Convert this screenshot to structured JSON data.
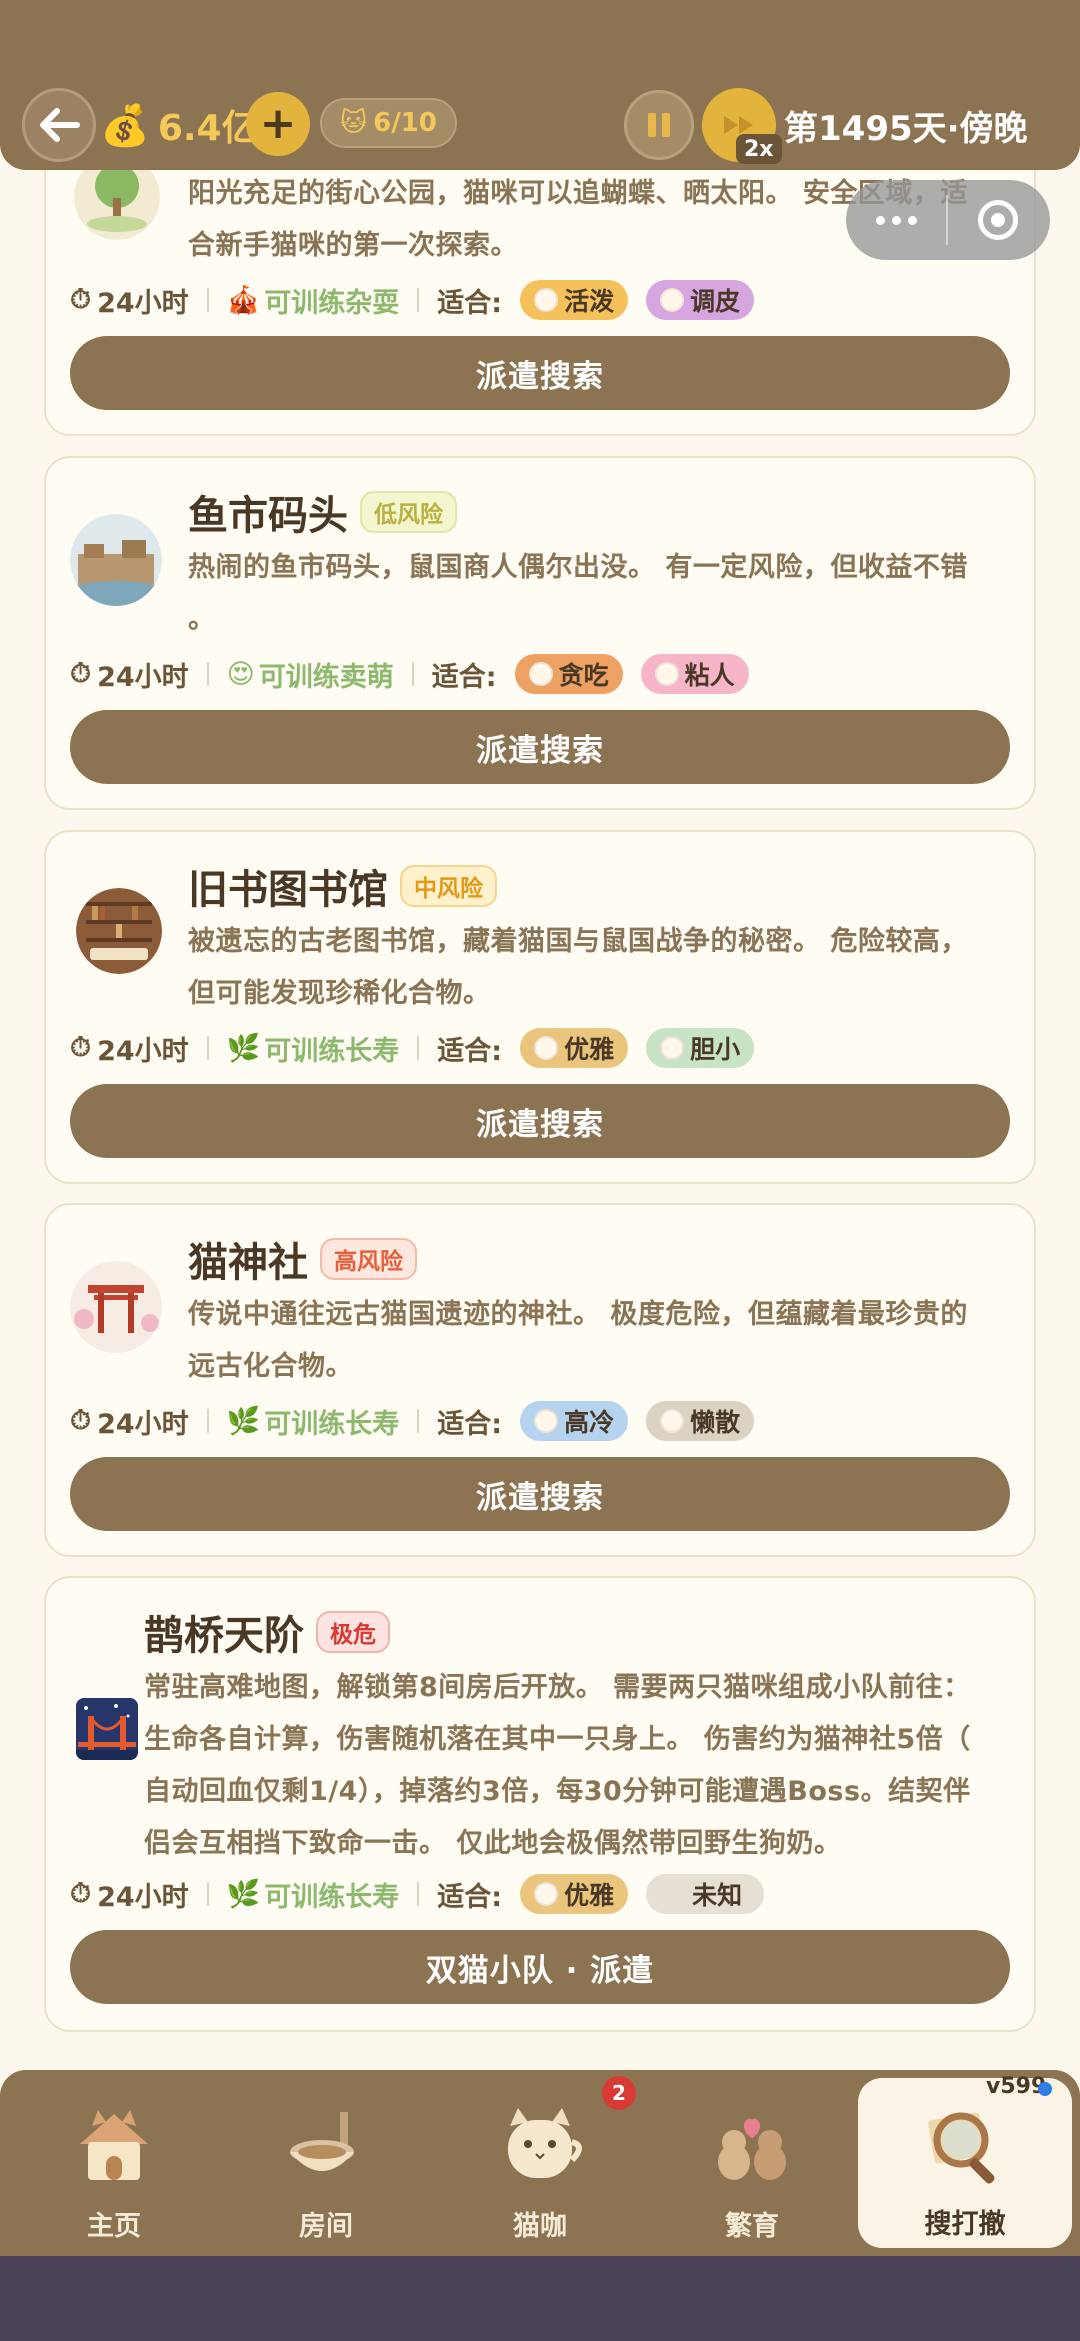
{
  "topbar": {
    "money": "6.4亿",
    "cat_count": "6/10",
    "speed": "2x",
    "day": "第1495天·傍晚"
  },
  "cards": [
    {
      "title": "",
      "risk": "",
      "desc": [
        "阳光充足的街心公园，猫咪可以追蝴蝶、晒太阳。 安全区域，适",
        "合新手猫咪的第一次探索。"
      ],
      "time": "24小时",
      "train": "可训练杂耍",
      "fit": "适合:",
      "tags": [
        "活泼",
        "调皮"
      ],
      "button": "派遣搜索"
    },
    {
      "title": "鱼市码头",
      "risk": "低风险",
      "desc": [
        "热闹的鱼市码头，鼠国商人偶尔出没。 有一定风险，但收益不错",
        "。"
      ],
      "time": "24小时",
      "train": "可训练卖萌",
      "fit": "适合:",
      "tags": [
        "贪吃",
        "粘人"
      ],
      "button": "派遣搜索"
    },
    {
      "title": "旧书图书馆",
      "risk": "中风险",
      "desc": [
        "被遗忘的古老图书馆，藏着猫国与鼠国战争的秘密。 危险较高，",
        "但可能发现珍稀化合物。"
      ],
      "time": "24小时",
      "train": "可训练长寿",
      "fit": "适合:",
      "tags": [
        "优雅",
        "胆小"
      ],
      "button": "派遣搜索"
    },
    {
      "title": "猫神社",
      "risk": "高风险",
      "desc": [
        "传说中通往远古猫国遗迹的神社。 极度危险，但蕴藏着最珍贵的",
        "远古化合物。"
      ],
      "time": "24小时",
      "train": "可训练长寿",
      "fit": "适合:",
      "tags": [
        "高冷",
        "懒散"
      ],
      "button": "派遣搜索"
    },
    {
      "title": "鹊桥天阶",
      "risk": "极危",
      "desc": [
        "常驻高难地图，解锁第8间房后开放。 需要两只猫咪组成小队前往：",
        "生命各自计算，伤害随机落在其中一只身上。 伤害约为猫神社5倍（",
        "自动回血仅剩1/4），掉落约3倍，每30分钟可能遭遇Boss。结契伴",
        "侣会互相挡下致命一击。 仅此地会极偶然带回野生狗奶。"
      ],
      "time": "24小时",
      "train": "可训练长寿",
      "fit": "适合:",
      "tags": [
        "优雅",
        "未知"
      ],
      "button": "双猫小队 · 派遣"
    }
  ],
  "nav": {
    "items": [
      "主页",
      "房间",
      "猫咖",
      "繁育",
      "搜打撤"
    ],
    "badge": "2",
    "version": "v599"
  },
  "colors": {
    "brand_brown": "#8c7452",
    "card_bg": "#fefcf3",
    "gold": "#f4c95a"
  }
}
